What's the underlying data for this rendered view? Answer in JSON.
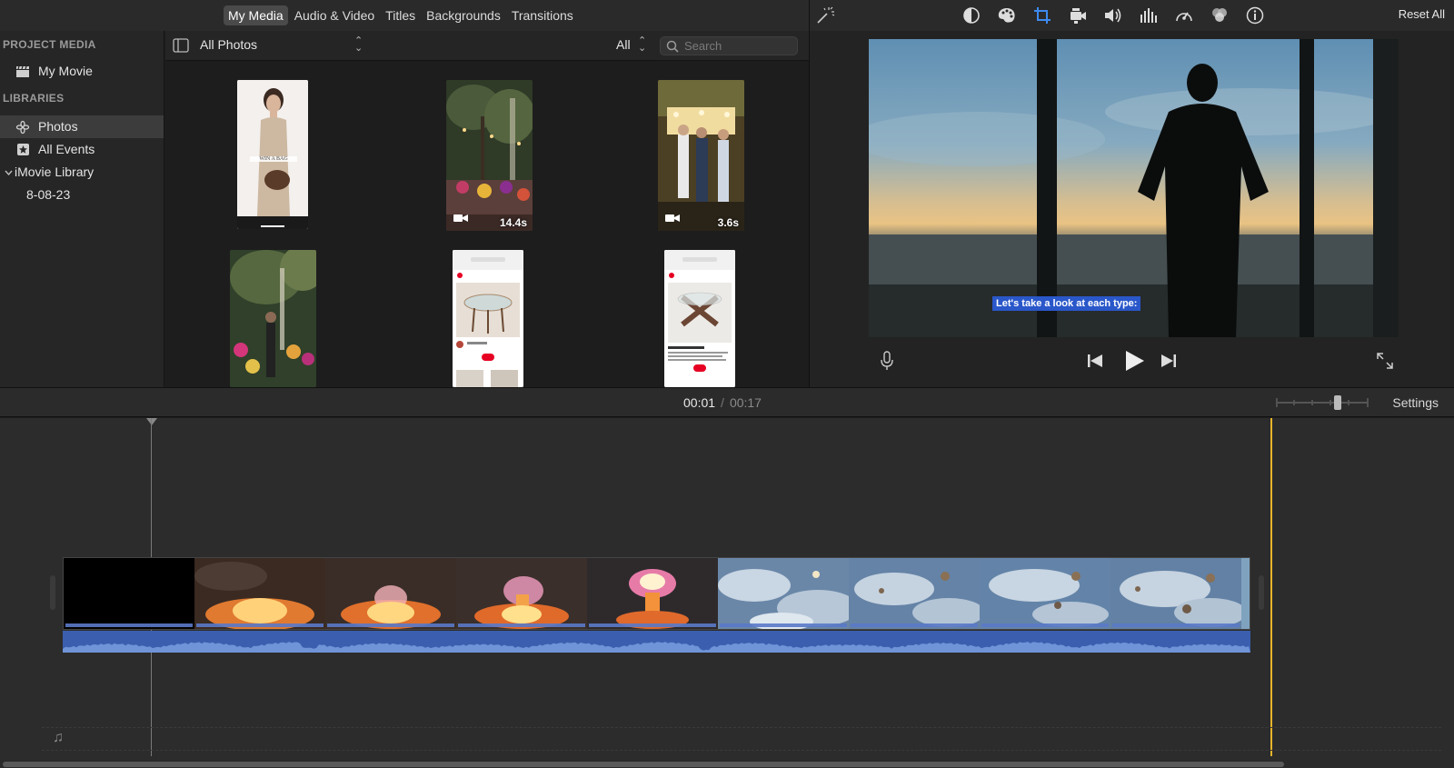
{
  "topbar": {
    "tabs": [
      {
        "label": "My Media"
      },
      {
        "label": "Audio & Video"
      },
      {
        "label": "Titles"
      },
      {
        "label": "Backgrounds"
      },
      {
        "label": "Transitions"
      }
    ],
    "active_tab": "My Media",
    "adjust_tools": [
      "color-balance-icon",
      "color-correction-icon",
      "crop-icon",
      "stabilization-icon",
      "volume-icon",
      "noise-reduction-equalizer-icon",
      "speed-icon",
      "clip-filter-icon",
      "info-icon"
    ],
    "reset_label": "Reset All"
  },
  "sidebar": {
    "project_media_heading": "PROJECT MEDIA",
    "project_item": "My Movie",
    "libraries_heading": "LIBRARIES",
    "items": [
      {
        "label": "Photos"
      },
      {
        "label": "All Events"
      },
      {
        "label": "iMovie Library"
      },
      {
        "label": "8-08-23"
      }
    ]
  },
  "browser": {
    "album": "All Photos",
    "filter": "All",
    "search_placeholder": "Search",
    "thumbnails": [
      {
        "kind": "photo"
      },
      {
        "kind": "video",
        "duration": "14.4s"
      },
      {
        "kind": "video",
        "duration": "3.6s"
      },
      {
        "kind": "photo"
      },
      {
        "kind": "photo"
      },
      {
        "kind": "photo"
      }
    ]
  },
  "viewer": {
    "caption": "Let's take a look at each type:"
  },
  "timeline": {
    "current_time": "00:01",
    "separator": "/",
    "total_time": "00:17",
    "settings_label": "Settings",
    "zoom_level": 0.68
  },
  "colors": {
    "accent": "#2a57c9",
    "playhead": "#e8b42a",
    "audio": "#3b5fae"
  }
}
